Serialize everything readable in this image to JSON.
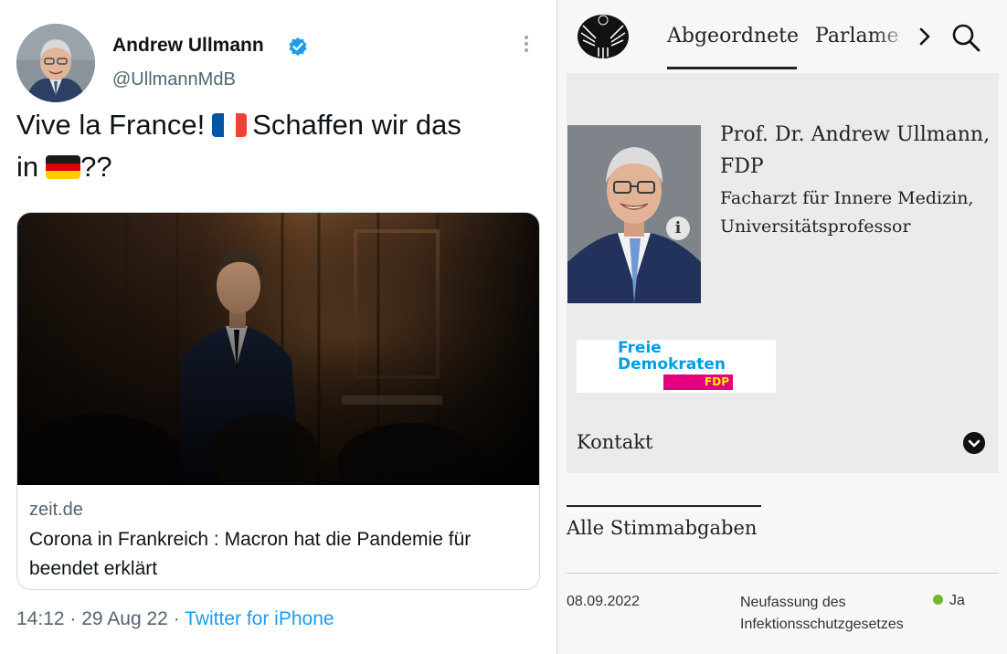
{
  "tweet": {
    "author_name": "Andrew Ullmann",
    "handle": "@UllmannMdB",
    "text_part1": "Vive la France!",
    "text_part2": "Schaffen wir das",
    "text_part3": "in",
    "text_part4": "??",
    "flags": [
      "flag-france-icon",
      "flag-germany-icon"
    ],
    "card": {
      "domain": "zeit.de",
      "title": "Corona in Frankreich : Macron hat die Pandemie für beendet erklärt"
    },
    "time": "14:12",
    "date": "29 Aug 22",
    "separator": "·",
    "source": "Twitter for iPhone",
    "colors": {
      "link": "#1d9bf0",
      "verified": "#1d9bf0",
      "secondary": "#536471"
    }
  },
  "bundestag": {
    "nav": {
      "tab_active": "Abgeordnete",
      "tab_next": "Parlament"
    },
    "profile": {
      "name": "Prof. Dr. Andrew Ullmann, FDP",
      "profession": "Facharzt für Innere Medizin, Universitätsprofessor",
      "info_badge": "i"
    },
    "party_logo": {
      "line1": "Freie",
      "line2": "Demokraten",
      "abbr": "FDP",
      "colors": {
        "text": "#009ee3",
        "box": "#e5007d",
        "abbr": "#ffed00"
      }
    },
    "kontakt_label": "Kontakt",
    "votes": {
      "title": "Alle Stimmabgaben",
      "rows": [
        {
          "date": "08.09.2022",
          "subject": "Neufassung des Infektionsschutzgesetzes",
          "result": "Ja",
          "status_color": "#74b72e"
        }
      ]
    }
  }
}
